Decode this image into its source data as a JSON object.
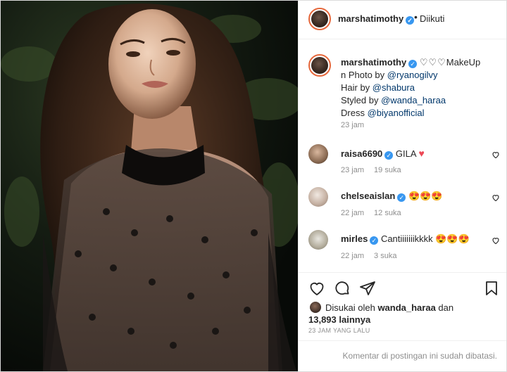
{
  "post": {
    "username": "marshatimothy",
    "verified_icon": "verified-badge-icon",
    "separator": "•",
    "follow_status": "Diikuti"
  },
  "caption": {
    "username": "marshatimothy",
    "hearts": "♡♡♡",
    "line1": "MakeUp",
    "line2_prefix": "n Photo by ",
    "line2_mention": "@ryanogilvy",
    "line3_prefix": "Hair by ",
    "line3_mention": "@shabura",
    "line4_prefix": "Styled by ",
    "line4_mention": "@wanda_haraa",
    "line5_prefix": "Dress ",
    "line5_mention": "@biyanofficial",
    "time": "23 jam"
  },
  "comments": [
    {
      "username": "raisa6690",
      "text": "GILA",
      "emoji": "♥",
      "time": "23 jam",
      "likes": "19 suka"
    },
    {
      "username": "chelseaislan",
      "text": "",
      "emoji": "😍😍😍",
      "time": "22 jam",
      "likes": "12 suka"
    },
    {
      "username": "mirles",
      "text": "Cantiiiiiiikkkk",
      "emoji": "😍😍😍",
      "time": "22 jam",
      "likes": "3 suka"
    }
  ],
  "likes": {
    "prefix": "Disukai oleh ",
    "user": "wanda_haraa",
    "connector": " dan",
    "count": "13,893 lainnya"
  },
  "posted_ago": "23 JAM YANG LALU",
  "footer_message": "Komentar di postingan ini sudah dibatasi.",
  "colors": {
    "link": "#00376b",
    "verified": "#3897f0",
    "muted": "#8e8e8e",
    "heart_red": "#ed4956"
  }
}
